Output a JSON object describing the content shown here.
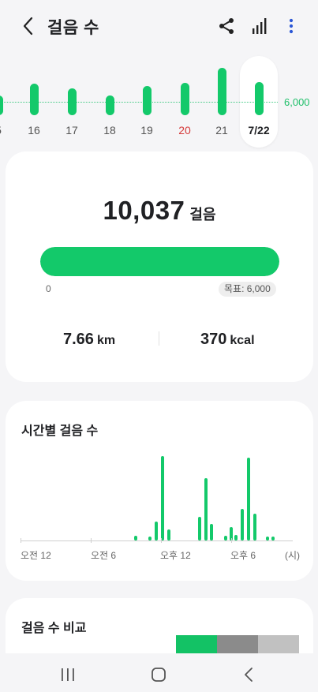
{
  "header": {
    "title": "걸음 수",
    "back_icon": "back-arrow-icon",
    "share_icon": "share-icon",
    "chart_icon": "bar-chart-icon",
    "more_icon": "more-vert-icon",
    "more_color": "#2b57d6"
  },
  "daily": {
    "goal_label": "6,000",
    "days": [
      {
        "label": "5",
        "steps": 6000,
        "color": "#555555"
      },
      {
        "label": "16",
        "steps": 9600,
        "color": "#555555"
      },
      {
        "label": "17",
        "steps": 8100,
        "color": "#555555"
      },
      {
        "label": "18",
        "steps": 5900,
        "color": "#555555"
      },
      {
        "label": "19",
        "steps": 9000,
        "color": "#555555"
      },
      {
        "label": "20",
        "steps": 9900,
        "color": "#d63a3a"
      },
      {
        "label": "21",
        "steps": 14300,
        "color": "#555555"
      },
      {
        "label": "7/22",
        "steps": 10037,
        "color": "#202124"
      }
    ]
  },
  "summary": {
    "steps": "10,037",
    "steps_unit": "걸음",
    "progress_fraction": 1.0,
    "zero_label": "0",
    "goal_chip": "목표: 6,000",
    "distance_value": "7.66",
    "distance_unit": "km",
    "calories_value": "370",
    "calories_unit": "kcal"
  },
  "hourly": {
    "title": "시간별 걸음 수",
    "labels": [
      "오전 12",
      "오전 6",
      "오후 12",
      "오후 6",
      "(시)"
    ],
    "bars": [
      {
        "t": 15.5,
        "v": 6
      },
      {
        "t": 17.5,
        "v": 5
      },
      {
        "t": 18.3,
        "v": 24
      },
      {
        "t": 19.2,
        "v": 107
      },
      {
        "t": 20.0,
        "v": 14
      },
      {
        "t": 24.2,
        "v": 30
      },
      {
        "t": 25.0,
        "v": 79
      },
      {
        "t": 25.8,
        "v": 21
      },
      {
        "t": 27.7,
        "v": 6
      },
      {
        "t": 28.4,
        "v": 17
      },
      {
        "t": 29.1,
        "v": 7
      },
      {
        "t": 29.9,
        "v": 40
      },
      {
        "t": 30.8,
        "v": 105
      },
      {
        "t": 31.6,
        "v": 34
      },
      {
        "t": 33.3,
        "v": 5
      },
      {
        "t": 34.1,
        "v": 5
      }
    ]
  },
  "compare": {
    "title": "걸음 수 비교",
    "segments": [
      {
        "color": "#13c265"
      },
      {
        "color": "#8b8b8b"
      },
      {
        "color": "#c1c1c1"
      }
    ]
  },
  "nav": {
    "recent_icon": "recent-apps-icon",
    "home_icon": "home-icon",
    "back_icon": "nav-back-icon"
  },
  "colors": {
    "accent": "#13c96a",
    "background": "#f5f5f7",
    "card": "#ffffff"
  }
}
